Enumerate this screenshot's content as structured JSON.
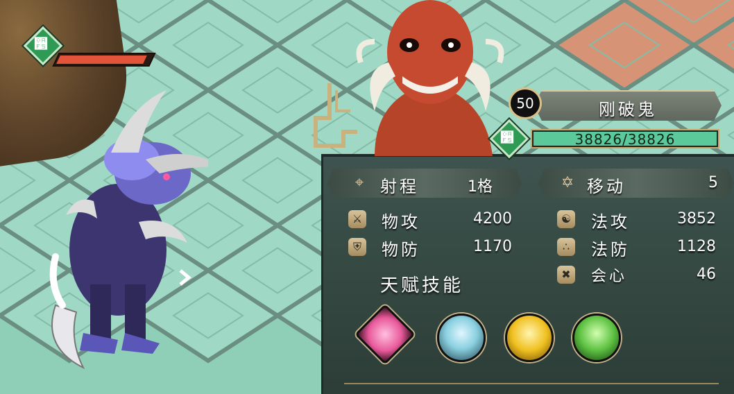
{
  "unit": {
    "level": "50",
    "name": "刚破鬼",
    "hp_text": "38826/38826",
    "hp_ratio": 1.0
  },
  "enemy_plate": {
    "hp_ratio": 0.98
  },
  "stats": {
    "range": {
      "label": "射程",
      "value": "1格",
      "icon": "target-icon"
    },
    "move": {
      "label": "移动",
      "value": "5",
      "icon": "boot-icon"
    },
    "phys_atk": {
      "label": "物攻",
      "value": "4200",
      "icon": "sword-icon"
    },
    "mag_atk": {
      "label": "法攻",
      "value": "3852",
      "icon": "yin-yang-icon"
    },
    "phys_def": {
      "label": "物防",
      "value": "1170",
      "icon": "shield-icon"
    },
    "mag_def": {
      "label": "法防",
      "value": "1128",
      "icon": "orbs-icon"
    },
    "crit": {
      "label": "会心",
      "value": "46",
      "icon": "crit-icon"
    }
  },
  "talent_title": "天赋技能",
  "skills": [
    {
      "name": "pink-burst-skill-icon",
      "color": "#e85a9a"
    },
    {
      "name": "ice-wave-skill-icon",
      "color": "#8ad0e0"
    },
    {
      "name": "gold-crescent-skill-icon",
      "color": "#f0c020"
    },
    {
      "name": "green-storm-skill-icon",
      "color": "#5cc040"
    }
  ],
  "colors": {
    "tile": "#9fd8c4",
    "tile_border": "#6fa898",
    "tile_orange": "#f08060",
    "hp_green": "#5cc99a",
    "hp_red": "#e2553a",
    "gold": "#c9a86a"
  }
}
